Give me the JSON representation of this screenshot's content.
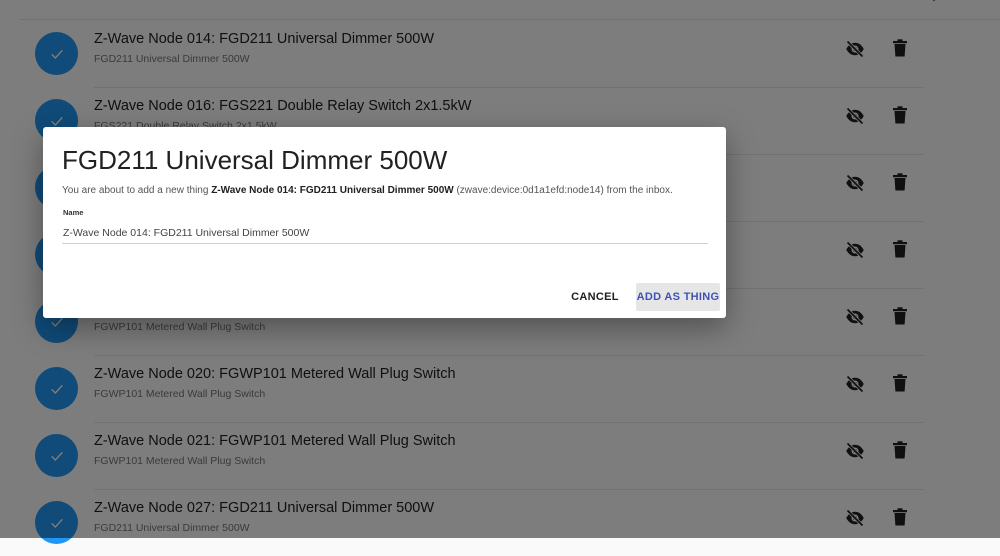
{
  "list": {
    "items": [
      {
        "title": "Z-Wave Node 014: FGD211 Universal Dimmer 500W",
        "subtitle": "FGD211 Universal Dimmer 500W"
      },
      {
        "title": "Z-Wave Node 016: FGS221 Double Relay Switch 2x1.5kW",
        "subtitle": "FGS221 Double Relay Switch 2x1.5kW"
      },
      {
        "title": "",
        "subtitle": ""
      },
      {
        "title": "",
        "subtitle": ""
      },
      {
        "title": "",
        "subtitle": "FGWP101 Metered Wall Plug Switch"
      },
      {
        "title": "Z-Wave Node 020: FGWP101 Metered Wall Plug Switch",
        "subtitle": "FGWP101 Metered Wall Plug Switch"
      },
      {
        "title": "Z-Wave Node 021: FGWP101 Metered Wall Plug Switch",
        "subtitle": "FGWP101 Metered Wall Plug Switch"
      },
      {
        "title": "Z-Wave Node 027: FGD211 Universal Dimmer 500W",
        "subtitle": "FGD211 Universal Dimmer 500W"
      }
    ]
  },
  "dialog": {
    "title": "FGD211 Universal Dimmer 500W",
    "text_prefix": "You are about to add a new thing ",
    "thing_name": "Z-Wave Node 014: FGD211 Universal Dimmer 500W",
    "text_suffix": " (zwave:device:0d1a1efd:node14) from the inbox.",
    "name_label": "Name",
    "name_value": "Z-Wave Node 014: FGD211 Universal Dimmer 500W",
    "cancel_label": "CANCEL",
    "add_label": "ADD AS THING"
  },
  "colors": {
    "accent": "#2196f3",
    "primary_button_text": "#3f51b5",
    "icon": "#212121"
  },
  "icons": {
    "avatar": "check-icon",
    "hide": "eye-off-icon",
    "delete": "trash-icon",
    "header": "chevron-down-icon"
  }
}
